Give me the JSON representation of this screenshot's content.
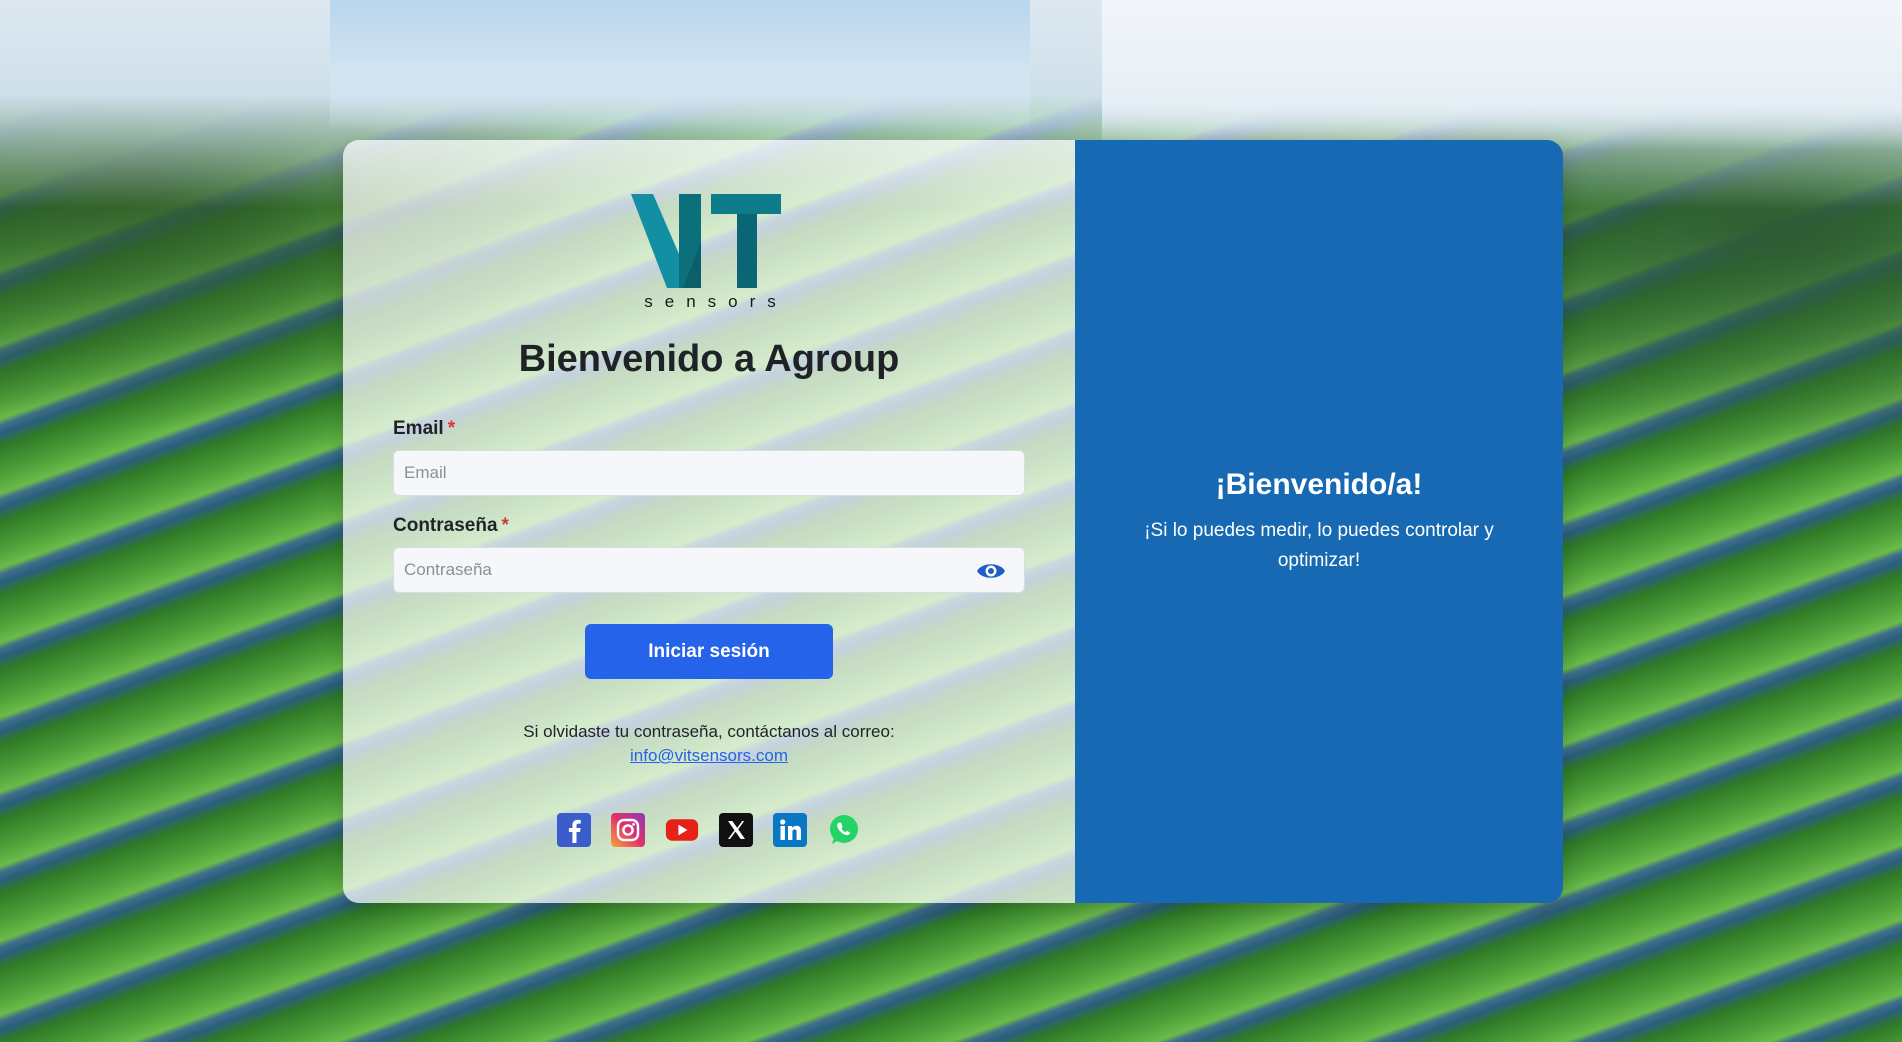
{
  "brand": {
    "logo_text": "VIT",
    "logo_subtitle": "sensors",
    "primary_color": "#2563eb",
    "panel_color": "#1769b3",
    "logo_teal": "#0f8a9c"
  },
  "login": {
    "heading": "Bienvenido a Agroup",
    "email_label": "Email",
    "email_placeholder": "Email",
    "password_label": "Contraseña",
    "password_placeholder": "Contraseña",
    "required_mark": "*",
    "submit_label": "Iniciar sesión",
    "help_text": "Si olvidaste tu contraseña, contáctanos al correo:",
    "help_email": "info@vitsensors.com"
  },
  "socials": [
    {
      "icon": "facebook-icon"
    },
    {
      "icon": "instagram-icon"
    },
    {
      "icon": "youtube-icon"
    },
    {
      "icon": "x-icon"
    },
    {
      "icon": "linkedin-icon"
    },
    {
      "icon": "whatsapp-icon"
    }
  ],
  "welcome": {
    "title": "¡Bienvenido/a!",
    "subtitle": "¡Si lo puedes medir, lo puedes controlar y optimizar!"
  }
}
